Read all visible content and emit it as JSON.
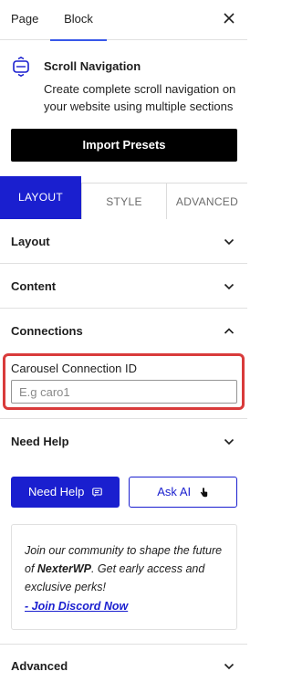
{
  "tabs": {
    "page": "Page",
    "block": "Block",
    "active": "block"
  },
  "block": {
    "title": "Scroll Navigation",
    "description": "Create complete scroll navigation on your website using multiple sections",
    "icon": "scroll-navigation-icon"
  },
  "import_label": "Import Presets",
  "seg_tabs": {
    "layout": "LAYOUT",
    "style": "STYLE",
    "advanced": "ADVANCED",
    "active": "layout"
  },
  "panels": {
    "layout": "Layout",
    "content": "Content",
    "connections": "Connections",
    "need_help": "Need Help",
    "advanced": "Advanced"
  },
  "connections": {
    "field_label": "Carousel Connection ID",
    "placeholder": "E.g caro1",
    "value": ""
  },
  "help": {
    "need_help_label": "Need Help",
    "ask_ai_label": "Ask AI",
    "community_intro": "Join our community to shape the future of ",
    "community_brand": "NexterWP",
    "community_outro": ". Get early access and exclusive perks!",
    "discord_link": "- Join Discord Now"
  },
  "colors": {
    "accent": "#1a1fcf",
    "highlight_border": "#d93b3b",
    "wp_tab_underline": "#3858e9",
    "dark_button": "#000000"
  }
}
